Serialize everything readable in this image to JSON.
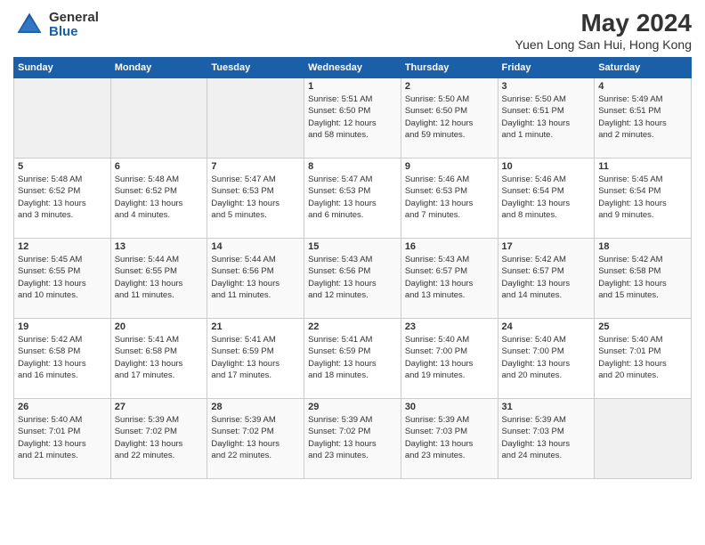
{
  "header": {
    "logo_general": "General",
    "logo_blue": "Blue",
    "main_title": "May 2024",
    "subtitle": "Yuen Long San Hui, Hong Kong"
  },
  "days_of_week": [
    "Sunday",
    "Monday",
    "Tuesday",
    "Wednesday",
    "Thursday",
    "Friday",
    "Saturday"
  ],
  "weeks": [
    [
      {
        "day": "",
        "info": ""
      },
      {
        "day": "",
        "info": ""
      },
      {
        "day": "",
        "info": ""
      },
      {
        "day": "1",
        "info": "Sunrise: 5:51 AM\nSunset: 6:50 PM\nDaylight: 12 hours\nand 58 minutes."
      },
      {
        "day": "2",
        "info": "Sunrise: 5:50 AM\nSunset: 6:50 PM\nDaylight: 12 hours\nand 59 minutes."
      },
      {
        "day": "3",
        "info": "Sunrise: 5:50 AM\nSunset: 6:51 PM\nDaylight: 13 hours\nand 1 minute."
      },
      {
        "day": "4",
        "info": "Sunrise: 5:49 AM\nSunset: 6:51 PM\nDaylight: 13 hours\nand 2 minutes."
      }
    ],
    [
      {
        "day": "5",
        "info": "Sunrise: 5:48 AM\nSunset: 6:52 PM\nDaylight: 13 hours\nand 3 minutes."
      },
      {
        "day": "6",
        "info": "Sunrise: 5:48 AM\nSunset: 6:52 PM\nDaylight: 13 hours\nand 4 minutes."
      },
      {
        "day": "7",
        "info": "Sunrise: 5:47 AM\nSunset: 6:53 PM\nDaylight: 13 hours\nand 5 minutes."
      },
      {
        "day": "8",
        "info": "Sunrise: 5:47 AM\nSunset: 6:53 PM\nDaylight: 13 hours\nand 6 minutes."
      },
      {
        "day": "9",
        "info": "Sunrise: 5:46 AM\nSunset: 6:53 PM\nDaylight: 13 hours\nand 7 minutes."
      },
      {
        "day": "10",
        "info": "Sunrise: 5:46 AM\nSunset: 6:54 PM\nDaylight: 13 hours\nand 8 minutes."
      },
      {
        "day": "11",
        "info": "Sunrise: 5:45 AM\nSunset: 6:54 PM\nDaylight: 13 hours\nand 9 minutes."
      }
    ],
    [
      {
        "day": "12",
        "info": "Sunrise: 5:45 AM\nSunset: 6:55 PM\nDaylight: 13 hours\nand 10 minutes."
      },
      {
        "day": "13",
        "info": "Sunrise: 5:44 AM\nSunset: 6:55 PM\nDaylight: 13 hours\nand 11 minutes."
      },
      {
        "day": "14",
        "info": "Sunrise: 5:44 AM\nSunset: 6:56 PM\nDaylight: 13 hours\nand 11 minutes."
      },
      {
        "day": "15",
        "info": "Sunrise: 5:43 AM\nSunset: 6:56 PM\nDaylight: 13 hours\nand 12 minutes."
      },
      {
        "day": "16",
        "info": "Sunrise: 5:43 AM\nSunset: 6:57 PM\nDaylight: 13 hours\nand 13 minutes."
      },
      {
        "day": "17",
        "info": "Sunrise: 5:42 AM\nSunset: 6:57 PM\nDaylight: 13 hours\nand 14 minutes."
      },
      {
        "day": "18",
        "info": "Sunrise: 5:42 AM\nSunset: 6:58 PM\nDaylight: 13 hours\nand 15 minutes."
      }
    ],
    [
      {
        "day": "19",
        "info": "Sunrise: 5:42 AM\nSunset: 6:58 PM\nDaylight: 13 hours\nand 16 minutes."
      },
      {
        "day": "20",
        "info": "Sunrise: 5:41 AM\nSunset: 6:58 PM\nDaylight: 13 hours\nand 17 minutes."
      },
      {
        "day": "21",
        "info": "Sunrise: 5:41 AM\nSunset: 6:59 PM\nDaylight: 13 hours\nand 17 minutes."
      },
      {
        "day": "22",
        "info": "Sunrise: 5:41 AM\nSunset: 6:59 PM\nDaylight: 13 hours\nand 18 minutes."
      },
      {
        "day": "23",
        "info": "Sunrise: 5:40 AM\nSunset: 7:00 PM\nDaylight: 13 hours\nand 19 minutes."
      },
      {
        "day": "24",
        "info": "Sunrise: 5:40 AM\nSunset: 7:00 PM\nDaylight: 13 hours\nand 20 minutes."
      },
      {
        "day": "25",
        "info": "Sunrise: 5:40 AM\nSunset: 7:01 PM\nDaylight: 13 hours\nand 20 minutes."
      }
    ],
    [
      {
        "day": "26",
        "info": "Sunrise: 5:40 AM\nSunset: 7:01 PM\nDaylight: 13 hours\nand 21 minutes."
      },
      {
        "day": "27",
        "info": "Sunrise: 5:39 AM\nSunset: 7:02 PM\nDaylight: 13 hours\nand 22 minutes."
      },
      {
        "day": "28",
        "info": "Sunrise: 5:39 AM\nSunset: 7:02 PM\nDaylight: 13 hours\nand 22 minutes."
      },
      {
        "day": "29",
        "info": "Sunrise: 5:39 AM\nSunset: 7:02 PM\nDaylight: 13 hours\nand 23 minutes."
      },
      {
        "day": "30",
        "info": "Sunrise: 5:39 AM\nSunset: 7:03 PM\nDaylight: 13 hours\nand 23 minutes."
      },
      {
        "day": "31",
        "info": "Sunrise: 5:39 AM\nSunset: 7:03 PM\nDaylight: 13 hours\nand 24 minutes."
      },
      {
        "day": "",
        "info": ""
      }
    ]
  ]
}
